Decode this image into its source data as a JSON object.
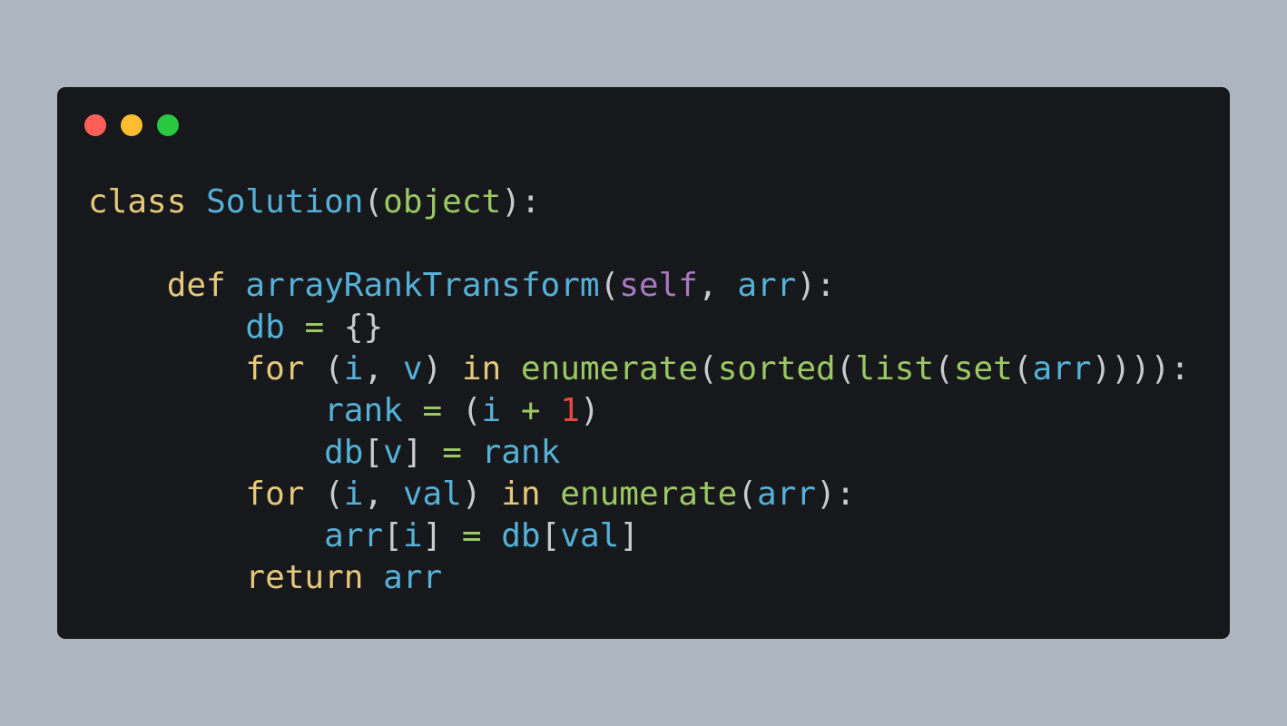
{
  "window": {
    "controls": [
      {
        "name": "close-button",
        "color": "#ff5f57"
      },
      {
        "name": "minimize-button",
        "color": "#febc2e"
      },
      {
        "name": "maximize-button",
        "color": "#28c840"
      }
    ]
  },
  "colors": {
    "background": "#adb5bf",
    "editor_background": "#17181b",
    "keyword": "#e5c87a",
    "identifier": "#54b1d8",
    "builtin": "#9bc863",
    "self": "#a878c3",
    "number": "#e4473f",
    "punctuation": "#c8cad0"
  },
  "code": {
    "lines": [
      [
        {
          "text": "class",
          "type": "keyword"
        },
        {
          "text": " ",
          "type": "space"
        },
        {
          "text": "Solution",
          "type": "class"
        },
        {
          "text": "(",
          "type": "punct"
        },
        {
          "text": "object",
          "type": "builtin"
        },
        {
          "text": "):",
          "type": "punct"
        }
      ],
      [],
      [
        {
          "text": "    ",
          "type": "space"
        },
        {
          "text": "def",
          "type": "keyword"
        },
        {
          "text": " ",
          "type": "space"
        },
        {
          "text": "arrayRankTransform",
          "type": "class"
        },
        {
          "text": "(",
          "type": "punct"
        },
        {
          "text": "self",
          "type": "self"
        },
        {
          "text": ", ",
          "type": "punct"
        },
        {
          "text": "arr",
          "type": "ident"
        },
        {
          "text": "):",
          "type": "punct"
        }
      ],
      [
        {
          "text": "        ",
          "type": "space"
        },
        {
          "text": "db",
          "type": "ident"
        },
        {
          "text": " ",
          "type": "space"
        },
        {
          "text": "=",
          "type": "op"
        },
        {
          "text": " {}",
          "type": "punct"
        }
      ],
      [
        {
          "text": "        ",
          "type": "space"
        },
        {
          "text": "for",
          "type": "keyword"
        },
        {
          "text": " (",
          "type": "punct"
        },
        {
          "text": "i",
          "type": "ident"
        },
        {
          "text": ", ",
          "type": "punct"
        },
        {
          "text": "v",
          "type": "ident"
        },
        {
          "text": ") ",
          "type": "punct"
        },
        {
          "text": "in",
          "type": "keyword"
        },
        {
          "text": " ",
          "type": "space"
        },
        {
          "text": "enumerate",
          "type": "builtin"
        },
        {
          "text": "(",
          "type": "punct"
        },
        {
          "text": "sorted",
          "type": "builtin"
        },
        {
          "text": "(",
          "type": "punct"
        },
        {
          "text": "list",
          "type": "builtin"
        },
        {
          "text": "(",
          "type": "punct"
        },
        {
          "text": "set",
          "type": "builtin"
        },
        {
          "text": "(",
          "type": "punct"
        },
        {
          "text": "arr",
          "type": "ident"
        },
        {
          "text": ")))):",
          "type": "punct"
        }
      ],
      [
        {
          "text": "            ",
          "type": "space"
        },
        {
          "text": "rank",
          "type": "ident"
        },
        {
          "text": " ",
          "type": "space"
        },
        {
          "text": "=",
          "type": "op"
        },
        {
          "text": " (",
          "type": "punct"
        },
        {
          "text": "i",
          "type": "ident"
        },
        {
          "text": " ",
          "type": "space"
        },
        {
          "text": "+",
          "type": "op"
        },
        {
          "text": " ",
          "type": "space"
        },
        {
          "text": "1",
          "type": "number"
        },
        {
          "text": ")",
          "type": "punct"
        }
      ],
      [
        {
          "text": "            ",
          "type": "space"
        },
        {
          "text": "db",
          "type": "ident"
        },
        {
          "text": "[",
          "type": "punct"
        },
        {
          "text": "v",
          "type": "ident"
        },
        {
          "text": "] ",
          "type": "punct"
        },
        {
          "text": "=",
          "type": "op"
        },
        {
          "text": " ",
          "type": "space"
        },
        {
          "text": "rank",
          "type": "ident"
        }
      ],
      [
        {
          "text": "        ",
          "type": "space"
        },
        {
          "text": "for",
          "type": "keyword"
        },
        {
          "text": " (",
          "type": "punct"
        },
        {
          "text": "i",
          "type": "ident"
        },
        {
          "text": ", ",
          "type": "punct"
        },
        {
          "text": "val",
          "type": "ident"
        },
        {
          "text": ") ",
          "type": "punct"
        },
        {
          "text": "in",
          "type": "keyword"
        },
        {
          "text": " ",
          "type": "space"
        },
        {
          "text": "enumerate",
          "type": "builtin"
        },
        {
          "text": "(",
          "type": "punct"
        },
        {
          "text": "arr",
          "type": "ident"
        },
        {
          "text": "):",
          "type": "punct"
        }
      ],
      [
        {
          "text": "            ",
          "type": "space"
        },
        {
          "text": "arr",
          "type": "ident"
        },
        {
          "text": "[",
          "type": "punct"
        },
        {
          "text": "i",
          "type": "ident"
        },
        {
          "text": "] ",
          "type": "punct"
        },
        {
          "text": "=",
          "type": "op"
        },
        {
          "text": " ",
          "type": "space"
        },
        {
          "text": "db",
          "type": "ident"
        },
        {
          "text": "[",
          "type": "punct"
        },
        {
          "text": "val",
          "type": "ident"
        },
        {
          "text": "]",
          "type": "punct"
        }
      ],
      [
        {
          "text": "        ",
          "type": "space"
        },
        {
          "text": "return",
          "type": "keyword"
        },
        {
          "text": " ",
          "type": "space"
        },
        {
          "text": "arr",
          "type": "ident"
        }
      ]
    ]
  }
}
